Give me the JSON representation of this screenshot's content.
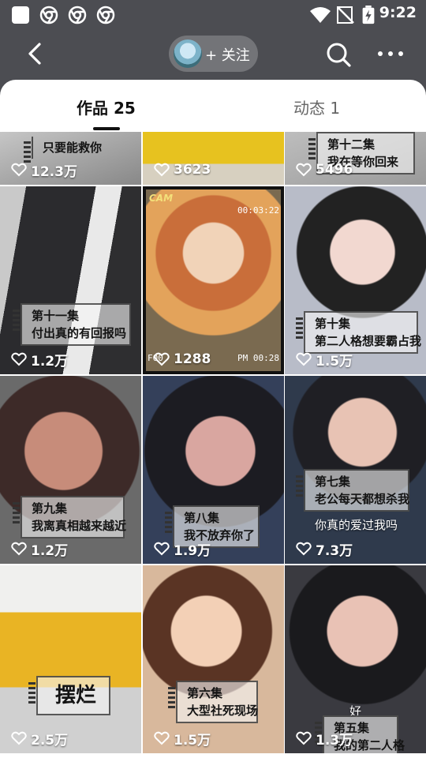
{
  "status_bar": {
    "time": "9:22",
    "icons": [
      "app-square-icon",
      "chrome-icon",
      "chrome-icon",
      "chrome-icon",
      "wifi-icon",
      "no-signal-icon",
      "battery-charging-icon"
    ]
  },
  "header": {
    "follow_label": "+ 关注"
  },
  "tabs": {
    "works": "作品 25",
    "moments": "动态 1"
  },
  "videos": [
    {
      "caption": [
        "只要能救你"
      ],
      "likes": "12.3万"
    },
    {
      "caption": [],
      "likes": "3623"
    },
    {
      "caption": [
        "第十二集",
        "我在等你回来"
      ],
      "likes": "5496"
    },
    {
      "caption": [
        "第十一集",
        "付出真的有回报吗"
      ],
      "likes": "1.2万"
    },
    {
      "caption": [],
      "likes": "1288",
      "overlay": {
        "cam": "CAM",
        "time": "00:03:22",
        "corner_left": "F00",
        "corner_right": "PM 00:28"
      }
    },
    {
      "caption": [
        "第十集",
        "第二人格想要霸占我"
      ],
      "likes": "1.5万"
    },
    {
      "caption": [
        "第九集",
        "我离真相越来越近"
      ],
      "likes": "1.2万"
    },
    {
      "caption": [
        "第八集",
        "我不放弃你了"
      ],
      "likes": "1.9万"
    },
    {
      "caption": [
        "第七集",
        "老公每天都想杀我"
      ],
      "subtitle": "你真的爱过我吗",
      "likes": "7.3万"
    },
    {
      "caption": [
        "摆烂"
      ],
      "likes": "2.5万"
    },
    {
      "caption": [
        "第六集",
        "大型社死现场"
      ],
      "likes": "1.5万"
    },
    {
      "caption": [
        "第五集",
        "我的第二人格"
      ],
      "subtitle": "好",
      "likes": "1.3万"
    }
  ],
  "colors": {
    "header_bg": "#4c4d52",
    "text_primary": "#111111",
    "text_secondary": "#666666"
  }
}
